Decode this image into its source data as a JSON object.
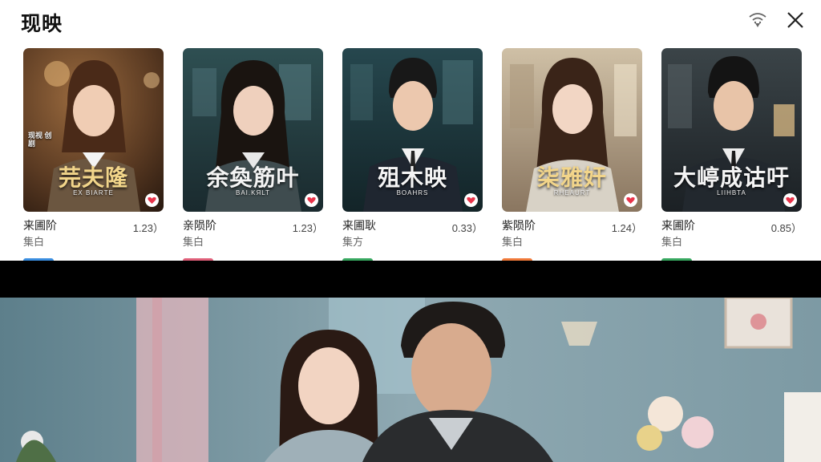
{
  "header": {
    "title": "现映",
    "cast_icon": "cast-icon",
    "close_icon": "close-icon"
  },
  "cards": [
    {
      "poster_title": "芫夫隆",
      "poster_sub": "EX ВІАRТЕ",
      "poster_logo": "现视 创剧",
      "title_color": "#f2d58a",
      "name": "来圃阶",
      "tag": "集白",
      "count": "1.23）",
      "chip_color": "#3a8ee0",
      "heart": "heart-icon"
    },
    {
      "poster_title": "余奐筋叶",
      "poster_sub": "BAI.KЯLT",
      "poster_logo": "",
      "title_color": "#f4f4f4",
      "name": "亲陨阶",
      "tag": "集白",
      "count": "1.23）",
      "chip_color": "#e0607a",
      "heart": "heart-icon"
    },
    {
      "poster_title": "殂木映",
      "poster_sub": "BOAHRS",
      "poster_logo": "",
      "title_color": "#f4f4f4",
      "name": "来圃耿",
      "tag": "集方",
      "count": "0.33）",
      "chip_color": "#38a860",
      "heart": "heart-icon"
    },
    {
      "poster_title": "柒雅奸",
      "poster_sub": "RHEAURT",
      "poster_logo": "",
      "title_color": "#f2d58a",
      "name": "紫陨阶",
      "tag": "集白",
      "count": "1.24）",
      "chip_color": "#f07a3a",
      "heart": "heart-icon"
    },
    {
      "poster_title": "大嵉成诂吁",
      "poster_sub": "LIIHBTA",
      "poster_logo": "",
      "title_color": "#f4f4f4",
      "name": "来圃阶",
      "tag": "集白",
      "count": "0.85）",
      "chip_color": "#38a860",
      "heart": "heart-icon"
    }
  ],
  "video": {
    "scene": "video-frame"
  }
}
